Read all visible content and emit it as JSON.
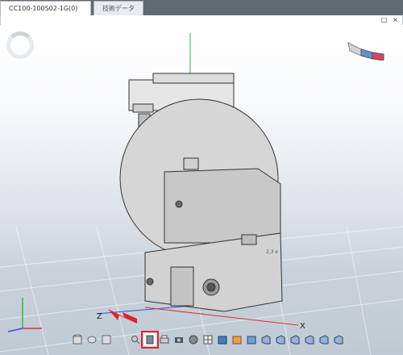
{
  "tabs": [
    {
      "label": "CC100-100S02-1G(0)",
      "active": true
    },
    {
      "label": "技術データ",
      "active": false
    }
  ],
  "window_controls": {
    "maximize": "□",
    "close": "×"
  },
  "viewport": {
    "axis_labels": {
      "x": "X",
      "z": "Z"
    },
    "dimension_label": "2,3 x"
  },
  "toolbar": {
    "icons": [
      "cylinder-view-icon",
      "cylinder-top-icon",
      "cylinder-front-icon",
      "separator",
      "zoom-icon",
      "section-view-icon",
      "print-icon",
      "camera-icon",
      "display-mode-icon",
      "grid-icon",
      "color-icon",
      "box-blue-icon",
      "box-front-icon",
      "box-back-icon",
      "box-left-icon",
      "box-right-icon",
      "box-top-icon",
      "box-bottom-icon",
      "box-iso-icon"
    ],
    "highlighted_index": 5
  },
  "colors": {
    "highlight": "#e0242c",
    "axis_x": "#e03030",
    "axis_y": "#22c040",
    "axis_z": "#3050e0",
    "arrow": "#e0242c"
  }
}
